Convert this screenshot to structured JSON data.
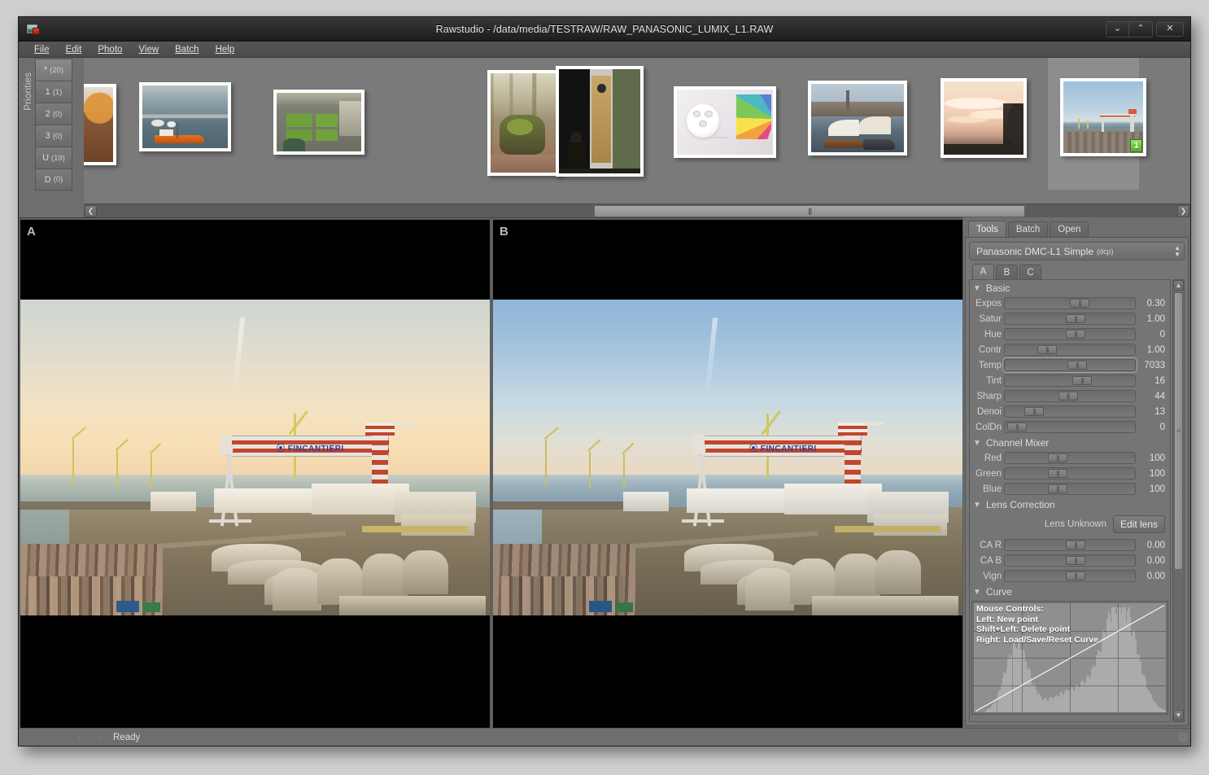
{
  "window": {
    "title": "Rawstudio - /data/media/TESTRAW/RAW_PANASONIC_LUMIX_L1.RAW",
    "app_icon": "rawstudio-icon",
    "buttons": {
      "minimize": "⌄",
      "maximize": "⌃",
      "close": "✕"
    }
  },
  "menubar": {
    "items": [
      {
        "label": "File",
        "mnemonic": "F"
      },
      {
        "label": "Edit",
        "mnemonic": "E"
      },
      {
        "label": "Photo",
        "mnemonic": "P"
      },
      {
        "label": "View",
        "mnemonic": "V"
      },
      {
        "label": "Batch",
        "mnemonic": "B"
      },
      {
        "label": "Help",
        "mnemonic": "H"
      }
    ]
  },
  "priorities": {
    "label": "Priorities",
    "buttons": [
      {
        "key": "*",
        "count": "(20)",
        "active": true
      },
      {
        "key": "1",
        "count": "(1)",
        "active": false
      },
      {
        "key": "2",
        "count": "(0)",
        "active": false
      },
      {
        "key": "3",
        "count": "(0)",
        "active": false
      },
      {
        "key": "U",
        "count": "(19)",
        "active": false
      },
      {
        "key": "D",
        "count": "(0)",
        "active": false
      }
    ]
  },
  "thumbnails": {
    "scroll_left_icon": "chevron-left-icon",
    "scroll_right_icon": "chevron-right-icon",
    "scrollbar_grip": "|||",
    "items": [
      {
        "name": "whisky-glass-on-table",
        "selected": false,
        "badge": null
      },
      {
        "name": "harbour-with-orange-boat",
        "selected": false,
        "badge": null
      },
      {
        "name": "courtyard-garden-aerial",
        "selected": false,
        "badge": null
      },
      {
        "name": "mossy-tree-stump-autumn",
        "selected": false,
        "badge": null
      },
      {
        "name": "speaker-and-lantern-indoor",
        "selected": false,
        "badge": null
      },
      {
        "name": "led-lamp-with-colour-swatches",
        "selected": false,
        "badge": null
      },
      {
        "name": "wooden-sailboats-at-quay",
        "selected": false,
        "badge": null
      },
      {
        "name": "sunset-clouds-over-trees",
        "selected": false,
        "badge": null
      },
      {
        "name": "shipyard-gantry-crane",
        "selected": true,
        "badge": "1"
      }
    ]
  },
  "previews": {
    "panes": [
      {
        "label": "A",
        "scene": "shipyard-warm"
      },
      {
        "label": "B",
        "scene": "shipyard-cool"
      }
    ]
  },
  "tools": {
    "tabs": [
      {
        "label": "Tools",
        "active": true
      },
      {
        "label": "Batch",
        "active": false
      },
      {
        "label": "Open",
        "active": false
      }
    ],
    "profile": {
      "name": "Panasonic DMC-L1 Simple",
      "suffix": "(dcp)",
      "chevron": "⌃⌄"
    },
    "snapshot_tabs": [
      {
        "label": "A",
        "active": true
      },
      {
        "label": "B",
        "active": false
      },
      {
        "label": "C",
        "active": false
      }
    ],
    "sections": [
      {
        "title": "Basic",
        "expanded": true,
        "sliders": [
          {
            "label": "Expos",
            "value": "0.30",
            "pos": 50,
            "focused": false
          },
          {
            "label": "Satur",
            "value": "1.00",
            "pos": 47,
            "focused": false
          },
          {
            "label": "Hue",
            "value": "0",
            "pos": 47,
            "focused": false
          },
          {
            "label": "Contr",
            "value": "1.00",
            "pos": 25,
            "focused": false
          },
          {
            "label": "Temp",
            "value": "7033",
            "pos": 48,
            "focused": true
          },
          {
            "label": "Tint",
            "value": "16",
            "pos": 52,
            "focused": false
          },
          {
            "label": "Sharp",
            "value": "44",
            "pos": 41,
            "focused": false
          },
          {
            "label": "Denoi",
            "value": "13",
            "pos": 15,
            "focused": false
          },
          {
            "label": "ColDn",
            "value": "0",
            "pos": 3,
            "focused": false
          }
        ]
      },
      {
        "title": "Channel Mixer",
        "expanded": true,
        "sliders": [
          {
            "label": "Red",
            "value": "100",
            "pos": 33,
            "focused": false
          },
          {
            "label": "Green",
            "value": "100",
            "pos": 33,
            "focused": false
          },
          {
            "label": "Blue",
            "value": "100",
            "pos": 33,
            "focused": false
          }
        ]
      },
      {
        "title": "Lens Correction",
        "expanded": true,
        "lens_status": "Lens Unknown",
        "edit_lens_label": "Edit lens",
        "sliders": [
          {
            "label": "CA R",
            "value": "0.00",
            "pos": 47,
            "focused": false
          },
          {
            "label": "CA B",
            "value": "0.00",
            "pos": 47,
            "focused": false
          },
          {
            "label": "Vign",
            "value": "0.00",
            "pos": 47,
            "focused": false
          }
        ]
      },
      {
        "title": "Curve",
        "expanded": true
      }
    ],
    "curve": {
      "help_lines": [
        "Mouse Controls:",
        "Left: New point",
        "Shift+Left: Delete point",
        "Right: Load/Save/Reset Curve"
      ]
    },
    "scrollbar": {
      "up_icon": "chevron-up-icon",
      "down_icon": "chevron-down-icon",
      "grip": "≡"
    }
  },
  "statusbar": {
    "dash_red": "-",
    "dash_green": "-",
    "dash_blue": "-",
    "text": "Ready",
    "colors": {
      "red": "#b05a5a",
      "green": "#7ea55e",
      "blue": "#6f8fc0"
    }
  },
  "colors": {
    "window_bg": "#6e6e6e",
    "titlebar": "#262626",
    "panel": "#757575",
    "accent_green": "#4fae2f",
    "brand_blue": "#20419a",
    "crane_red": "#c2462c"
  }
}
